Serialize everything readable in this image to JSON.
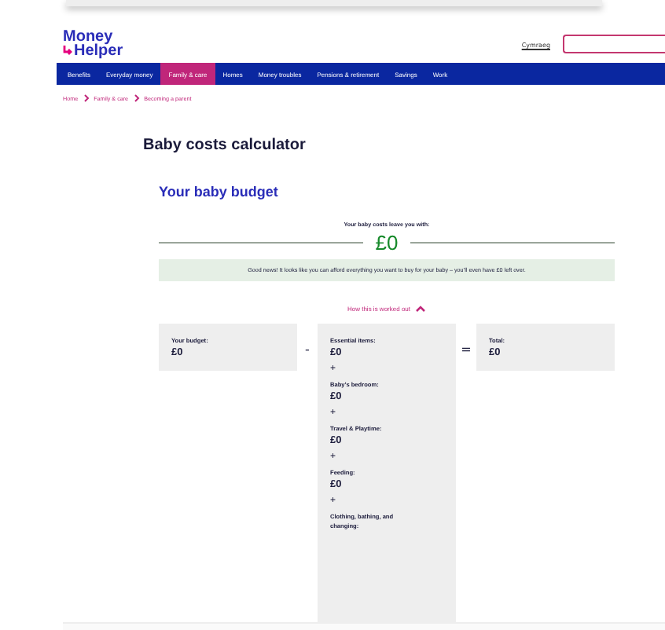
{
  "header": {
    "logo": [
      "Money",
      "Helper"
    ],
    "language_link": "Cymraeg"
  },
  "nav": [
    {
      "label": "Benefits",
      "selected": false
    },
    {
      "label": "Everyday money",
      "selected": false
    },
    {
      "label": "Family & care",
      "selected": true
    },
    {
      "label": "Homes",
      "selected": false
    },
    {
      "label": "Money troubles",
      "selected": false
    },
    {
      "label": "Pensions & retirement",
      "selected": false
    },
    {
      "label": "Savings",
      "selected": false
    },
    {
      "label": "Work",
      "selected": false
    }
  ],
  "breadcrumb": [
    "Home",
    "Family & care",
    "Becoming a parent"
  ],
  "title": "Baby costs calculator",
  "budget": {
    "heading": "Your baby budget",
    "result_label": "Your baby costs leave you with:",
    "result_value": "£0",
    "message": "Good news! It looks like you can afford everything you want to buy for your baby – you’ll even have £0 left over.",
    "toggle": {
      "label": "How this is worked out",
      "expanded": true
    },
    "budget_card": {
      "label": "Your budget:",
      "value": "£0"
    },
    "minus": "-",
    "costs": [
      {
        "label": "Essential items:",
        "value": "£0"
      },
      {
        "label": "Baby’s bedroom:",
        "value": "£0"
      },
      {
        "label": "Travel & Playtime:",
        "value": "£0"
      },
      {
        "label": "Feeding:",
        "value": "£0"
      },
      {
        "label": "Clothing, bathing, and changing:"
      }
    ],
    "plus": "+",
    "equals": "=",
    "total_card": {
      "label": "Total:",
      "value": "£0"
    }
  }
}
